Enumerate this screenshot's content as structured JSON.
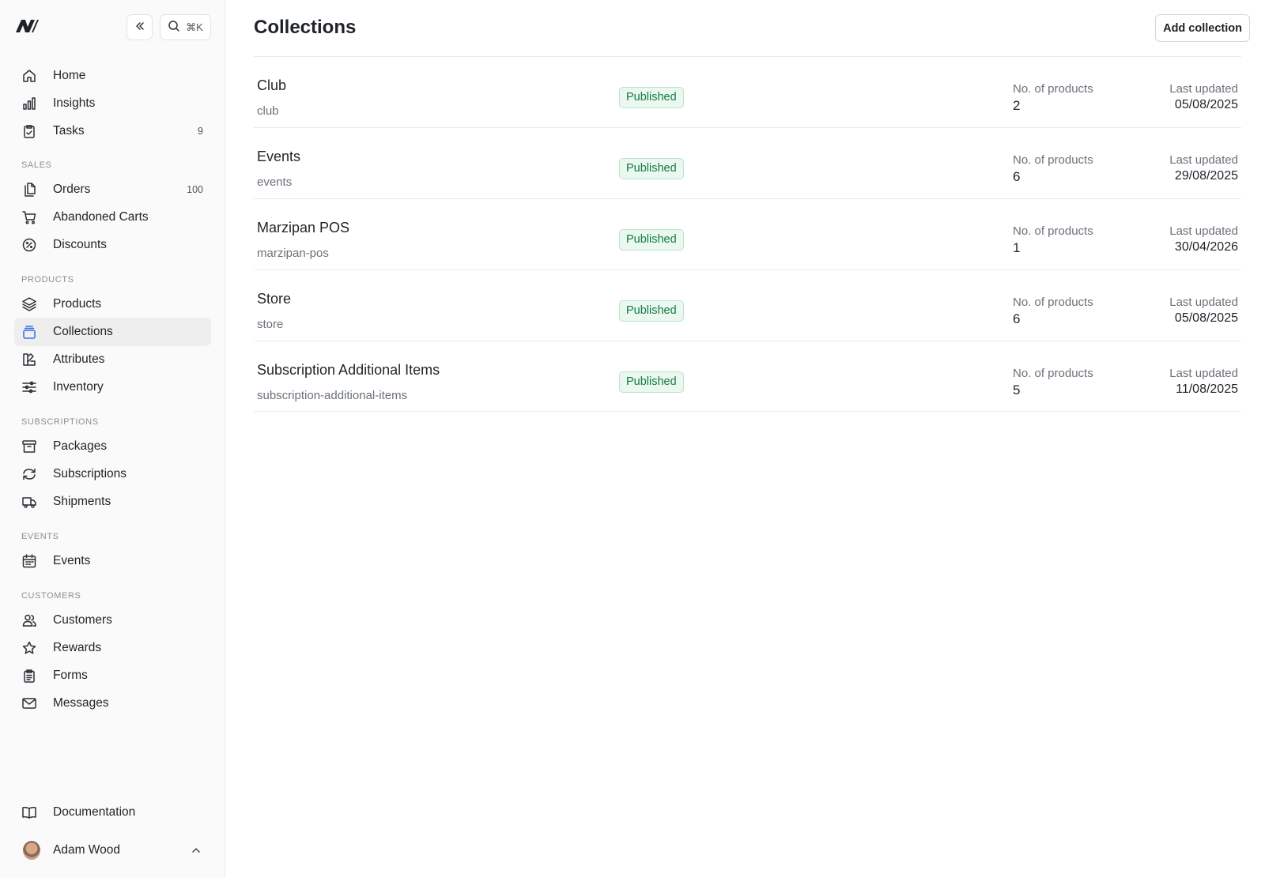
{
  "sidebar": {
    "search_shortcut": "⌘K",
    "main_items": [
      {
        "label": "Home",
        "icon": "home-icon"
      },
      {
        "label": "Insights",
        "icon": "bar-chart-icon"
      },
      {
        "label": "Tasks",
        "icon": "clipboard-check-icon",
        "count": "9"
      }
    ],
    "sections": [
      {
        "title": "Sales",
        "items": [
          {
            "label": "Orders",
            "icon": "documents-icon",
            "count": "100"
          },
          {
            "label": "Abandoned Carts",
            "icon": "cart-icon"
          },
          {
            "label": "Discounts",
            "icon": "discount-icon"
          }
        ]
      },
      {
        "title": "Products",
        "items": [
          {
            "label": "Products",
            "icon": "layers-icon"
          },
          {
            "label": "Collections",
            "icon": "collection-icon",
            "active": true
          },
          {
            "label": "Attributes",
            "icon": "attributes-icon"
          },
          {
            "label": "Inventory",
            "icon": "sliders-icon"
          }
        ]
      },
      {
        "title": "Subscriptions",
        "items": [
          {
            "label": "Packages",
            "icon": "archive-icon"
          },
          {
            "label": "Subscriptions",
            "icon": "refresh-icon"
          },
          {
            "label": "Shipments",
            "icon": "truck-icon"
          }
        ]
      },
      {
        "title": "Events",
        "items": [
          {
            "label": "Events",
            "icon": "calendar-icon"
          }
        ]
      },
      {
        "title": "Customers",
        "items": [
          {
            "label": "Customers",
            "icon": "users-icon"
          },
          {
            "label": "Rewards",
            "icon": "star-icon"
          },
          {
            "label": "Forms",
            "icon": "forms-icon"
          },
          {
            "label": "Messages",
            "icon": "mail-icon"
          }
        ]
      }
    ],
    "documentation": "Documentation",
    "user_name": "Adam Wood"
  },
  "header": {
    "title": "Collections",
    "add_label": "Add collection"
  },
  "collections": [
    {
      "name": "Club",
      "slug": "club",
      "status": "Published",
      "count_label": "No. of products",
      "count": "2",
      "updated_label": "Last updated",
      "updated": "05/08/2025"
    },
    {
      "name": "Events",
      "slug": "events",
      "status": "Published",
      "count_label": "No. of products",
      "count": "6",
      "updated_label": "Last updated",
      "updated": "29/08/2025"
    },
    {
      "name": "Marzipan POS",
      "slug": "marzipan-pos",
      "status": "Published",
      "count_label": "No. of products",
      "count": "1",
      "updated_label": "Last updated",
      "updated": "30/04/2026"
    },
    {
      "name": "Store",
      "slug": "store",
      "status": "Published",
      "count_label": "No. of products",
      "count": "6",
      "updated_label": "Last updated",
      "updated": "05/08/2025"
    },
    {
      "name": "Subscription Additional Items",
      "slug": "subscription-additional-items",
      "status": "Published",
      "count_label": "No. of products",
      "count": "5",
      "updated_label": "Last updated",
      "updated": "11/08/2025"
    }
  ]
}
